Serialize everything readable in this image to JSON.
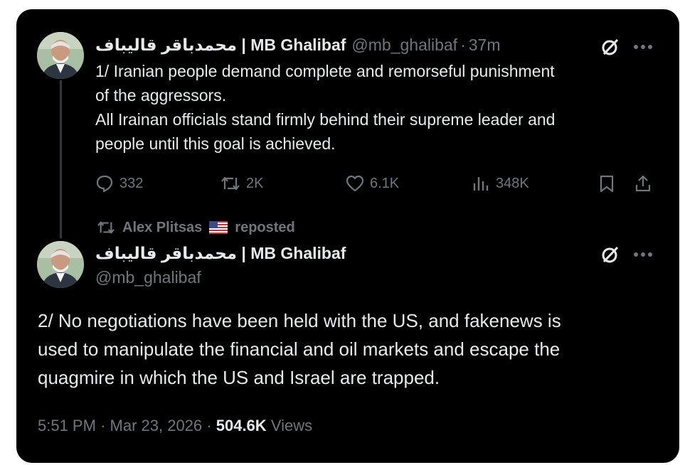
{
  "tweet1": {
    "display_name": "محمدباقر قالیباف | MB Ghalibaf",
    "handle": "@mb_ghalibaf",
    "separator": "·",
    "time": "37m",
    "text": "1/ Iranian people demand complete and remorseful punishment\nof the aggressors.\nAll Irainan officials stand firmly behind their supreme leader and\npeople until this goal is achieved.",
    "actions": {
      "replies": "332",
      "reposts": "2K",
      "likes": "6.1K",
      "views": "348K"
    }
  },
  "repost_banner": {
    "user": "Alex Plitsas",
    "flag": "us-flag",
    "label": "reposted"
  },
  "tweet2": {
    "display_name": "محمدباقر قالیباف | MB Ghalibaf",
    "handle": "@mb_ghalibaf",
    "text": "2/ No negotiations have been held with the US, and fakenews is\nused to manipulate the financial and oil markets and escape the\nquagmire in which the US and Israel are trapped.",
    "time": "5:51 PM",
    "date": "Mar 23, 2026",
    "views_count": "504.6K",
    "views_label": "Views"
  },
  "icons": {
    "grok": "grok-icon",
    "more": "more-icon",
    "reply": "reply-icon",
    "repost": "repost-icon",
    "like": "heart-icon",
    "views": "analytics-icon",
    "bookmark": "bookmark-icon",
    "share": "share-icon"
  },
  "colors": {
    "background": "#000000",
    "text": "#e7e9ea",
    "muted": "#71767b"
  }
}
